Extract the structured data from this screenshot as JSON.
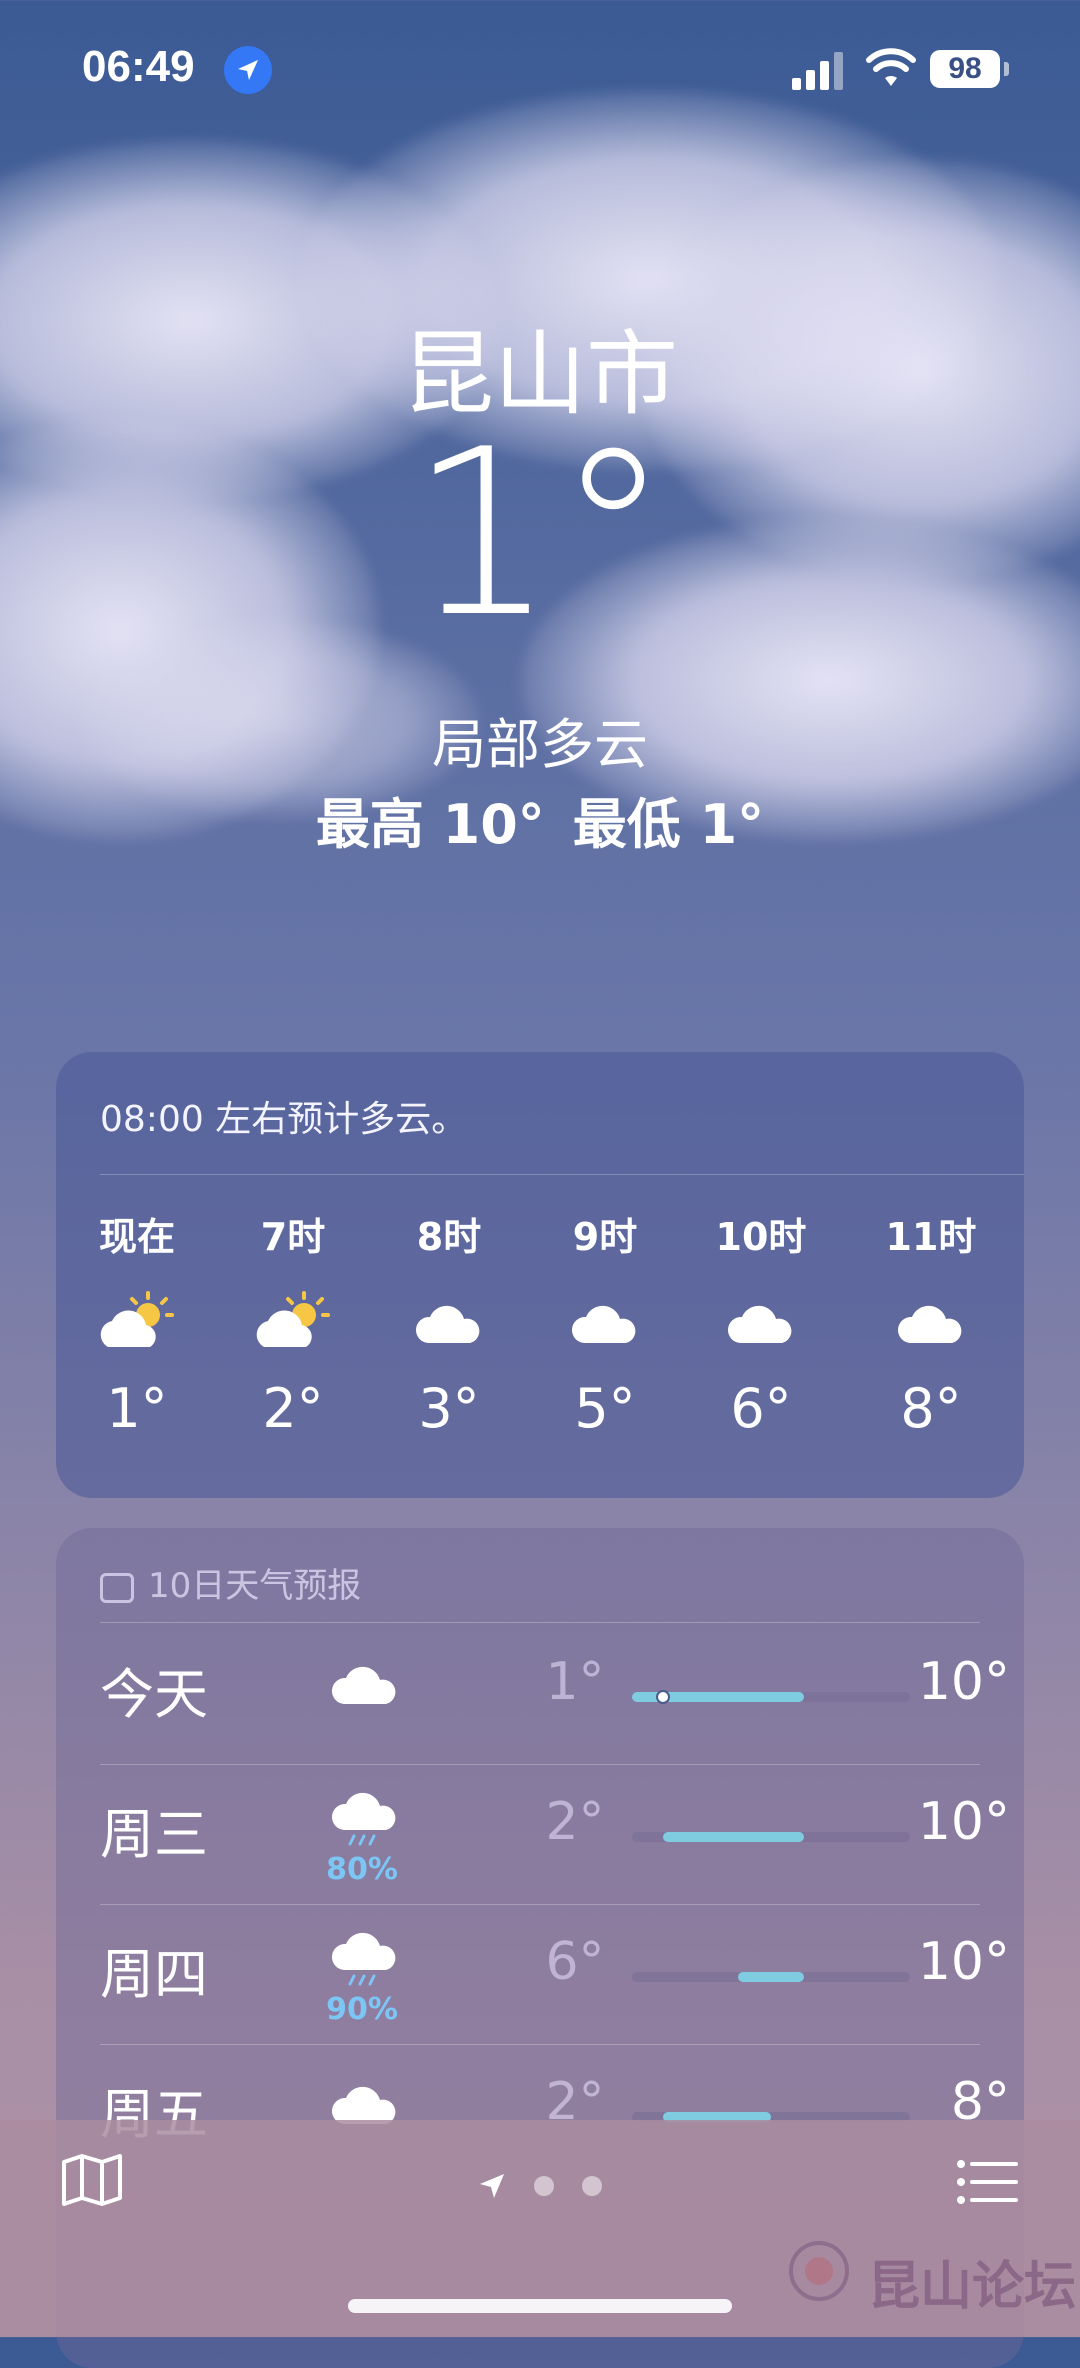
{
  "status_bar": {
    "time": "06:49",
    "battery": "98"
  },
  "header": {
    "city": "昆山市",
    "temperature": "1°",
    "condition": "局部多云",
    "high": "最高 10°",
    "low": "最低 1°"
  },
  "hourly": {
    "summary": "08:00 左右预计多云。",
    "hours": [
      {
        "label": "现在",
        "icon": "partly-sunny-icon",
        "temp": "1°"
      },
      {
        "label": "7时",
        "icon": "partly-sunny-icon",
        "temp": "2°"
      },
      {
        "label": "8时",
        "icon": "cloud-icon",
        "temp": "3°"
      },
      {
        "label": "9时",
        "icon": "cloud-icon",
        "temp": "5°"
      },
      {
        "label": "10时",
        "icon": "cloud-icon",
        "temp": "6°"
      },
      {
        "label": "11时",
        "icon": "cloud-icon",
        "temp": "8°"
      }
    ]
  },
  "forecast": {
    "title": "10日天气预报",
    "days": [
      {
        "day": "今天",
        "icon": "cloud-icon",
        "precip": "",
        "low": "1°",
        "high": "10°",
        "range_start": 0.0,
        "range_end": 0.62,
        "current": 0.11
      },
      {
        "day": "周三",
        "icon": "rain-icon",
        "precip": "80%",
        "low": "2°",
        "high": "10°",
        "range_start": 0.11,
        "range_end": 0.62
      },
      {
        "day": "周四",
        "icon": "rain-icon",
        "precip": "90%",
        "low": "6°",
        "high": "10°",
        "range_start": 0.38,
        "range_end": 0.62
      },
      {
        "day": "周五",
        "icon": "cloud-icon",
        "precip": "",
        "low": "2°",
        "high": "8°",
        "range_start": 0.11,
        "range_end": 0.5
      }
    ]
  },
  "watermark": "昆山论坛",
  "colors": {
    "accent": "#3478f6",
    "range_bar": "#7fcbe0",
    "precip": "#7cc6f6"
  }
}
